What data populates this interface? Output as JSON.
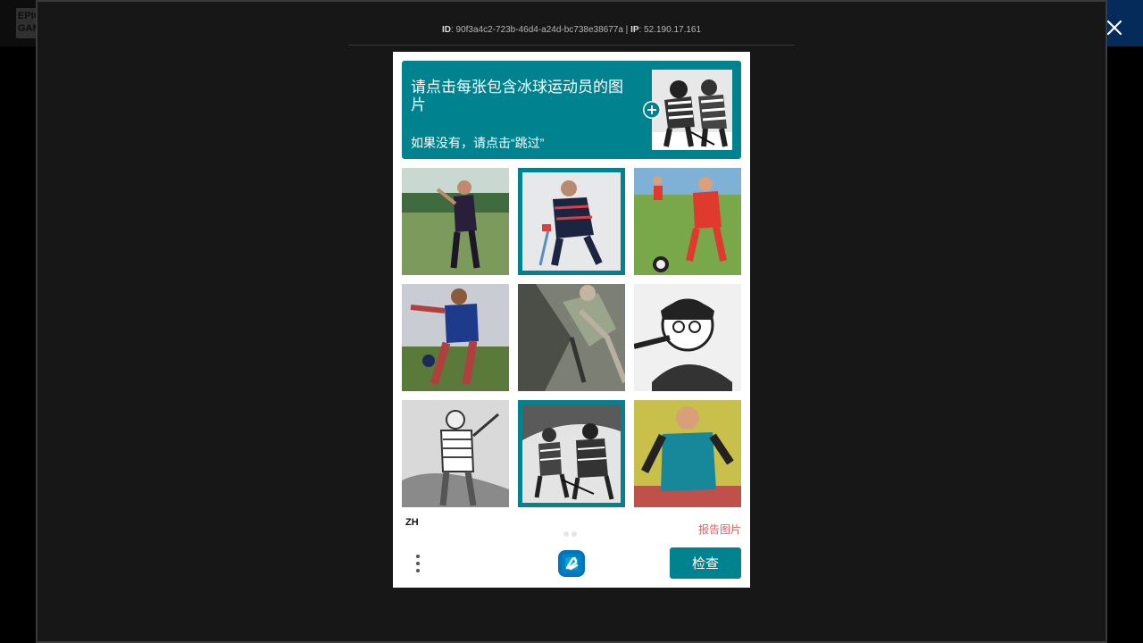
{
  "background": {
    "logo_text": "EPIC GAMES",
    "accent": "#0b61c7"
  },
  "modal": {
    "id_label": "ID",
    "request_id": "90f3a4c2-723b-46d4-a24d-bc738e38677a",
    "ip_label": "IP",
    "ip": "52.190.17.161",
    "close_icon": "close-icon"
  },
  "captcha": {
    "prompt": "请点击每张包含冰球运动员的图片",
    "prompt_sub": "如果没有，请点击“跳过”",
    "example_alt": "ice hockey example",
    "tiles": [
      {
        "subject": "golfer",
        "selected": false
      },
      {
        "subject": "hockey player",
        "selected": true
      },
      {
        "subject": "soccer player",
        "selected": false
      },
      {
        "subject": "soccer kicker",
        "selected": false
      },
      {
        "subject": "golfer sketch",
        "selected": false
      },
      {
        "subject": "baseball batter",
        "selected": false
      },
      {
        "subject": "golfer swing",
        "selected": false
      },
      {
        "subject": "hockey players",
        "selected": true
      },
      {
        "subject": "person",
        "selected": false
      }
    ],
    "language": "ZH",
    "report_label": "报告图片",
    "verify_label": "检查",
    "accent": "#00838f"
  }
}
